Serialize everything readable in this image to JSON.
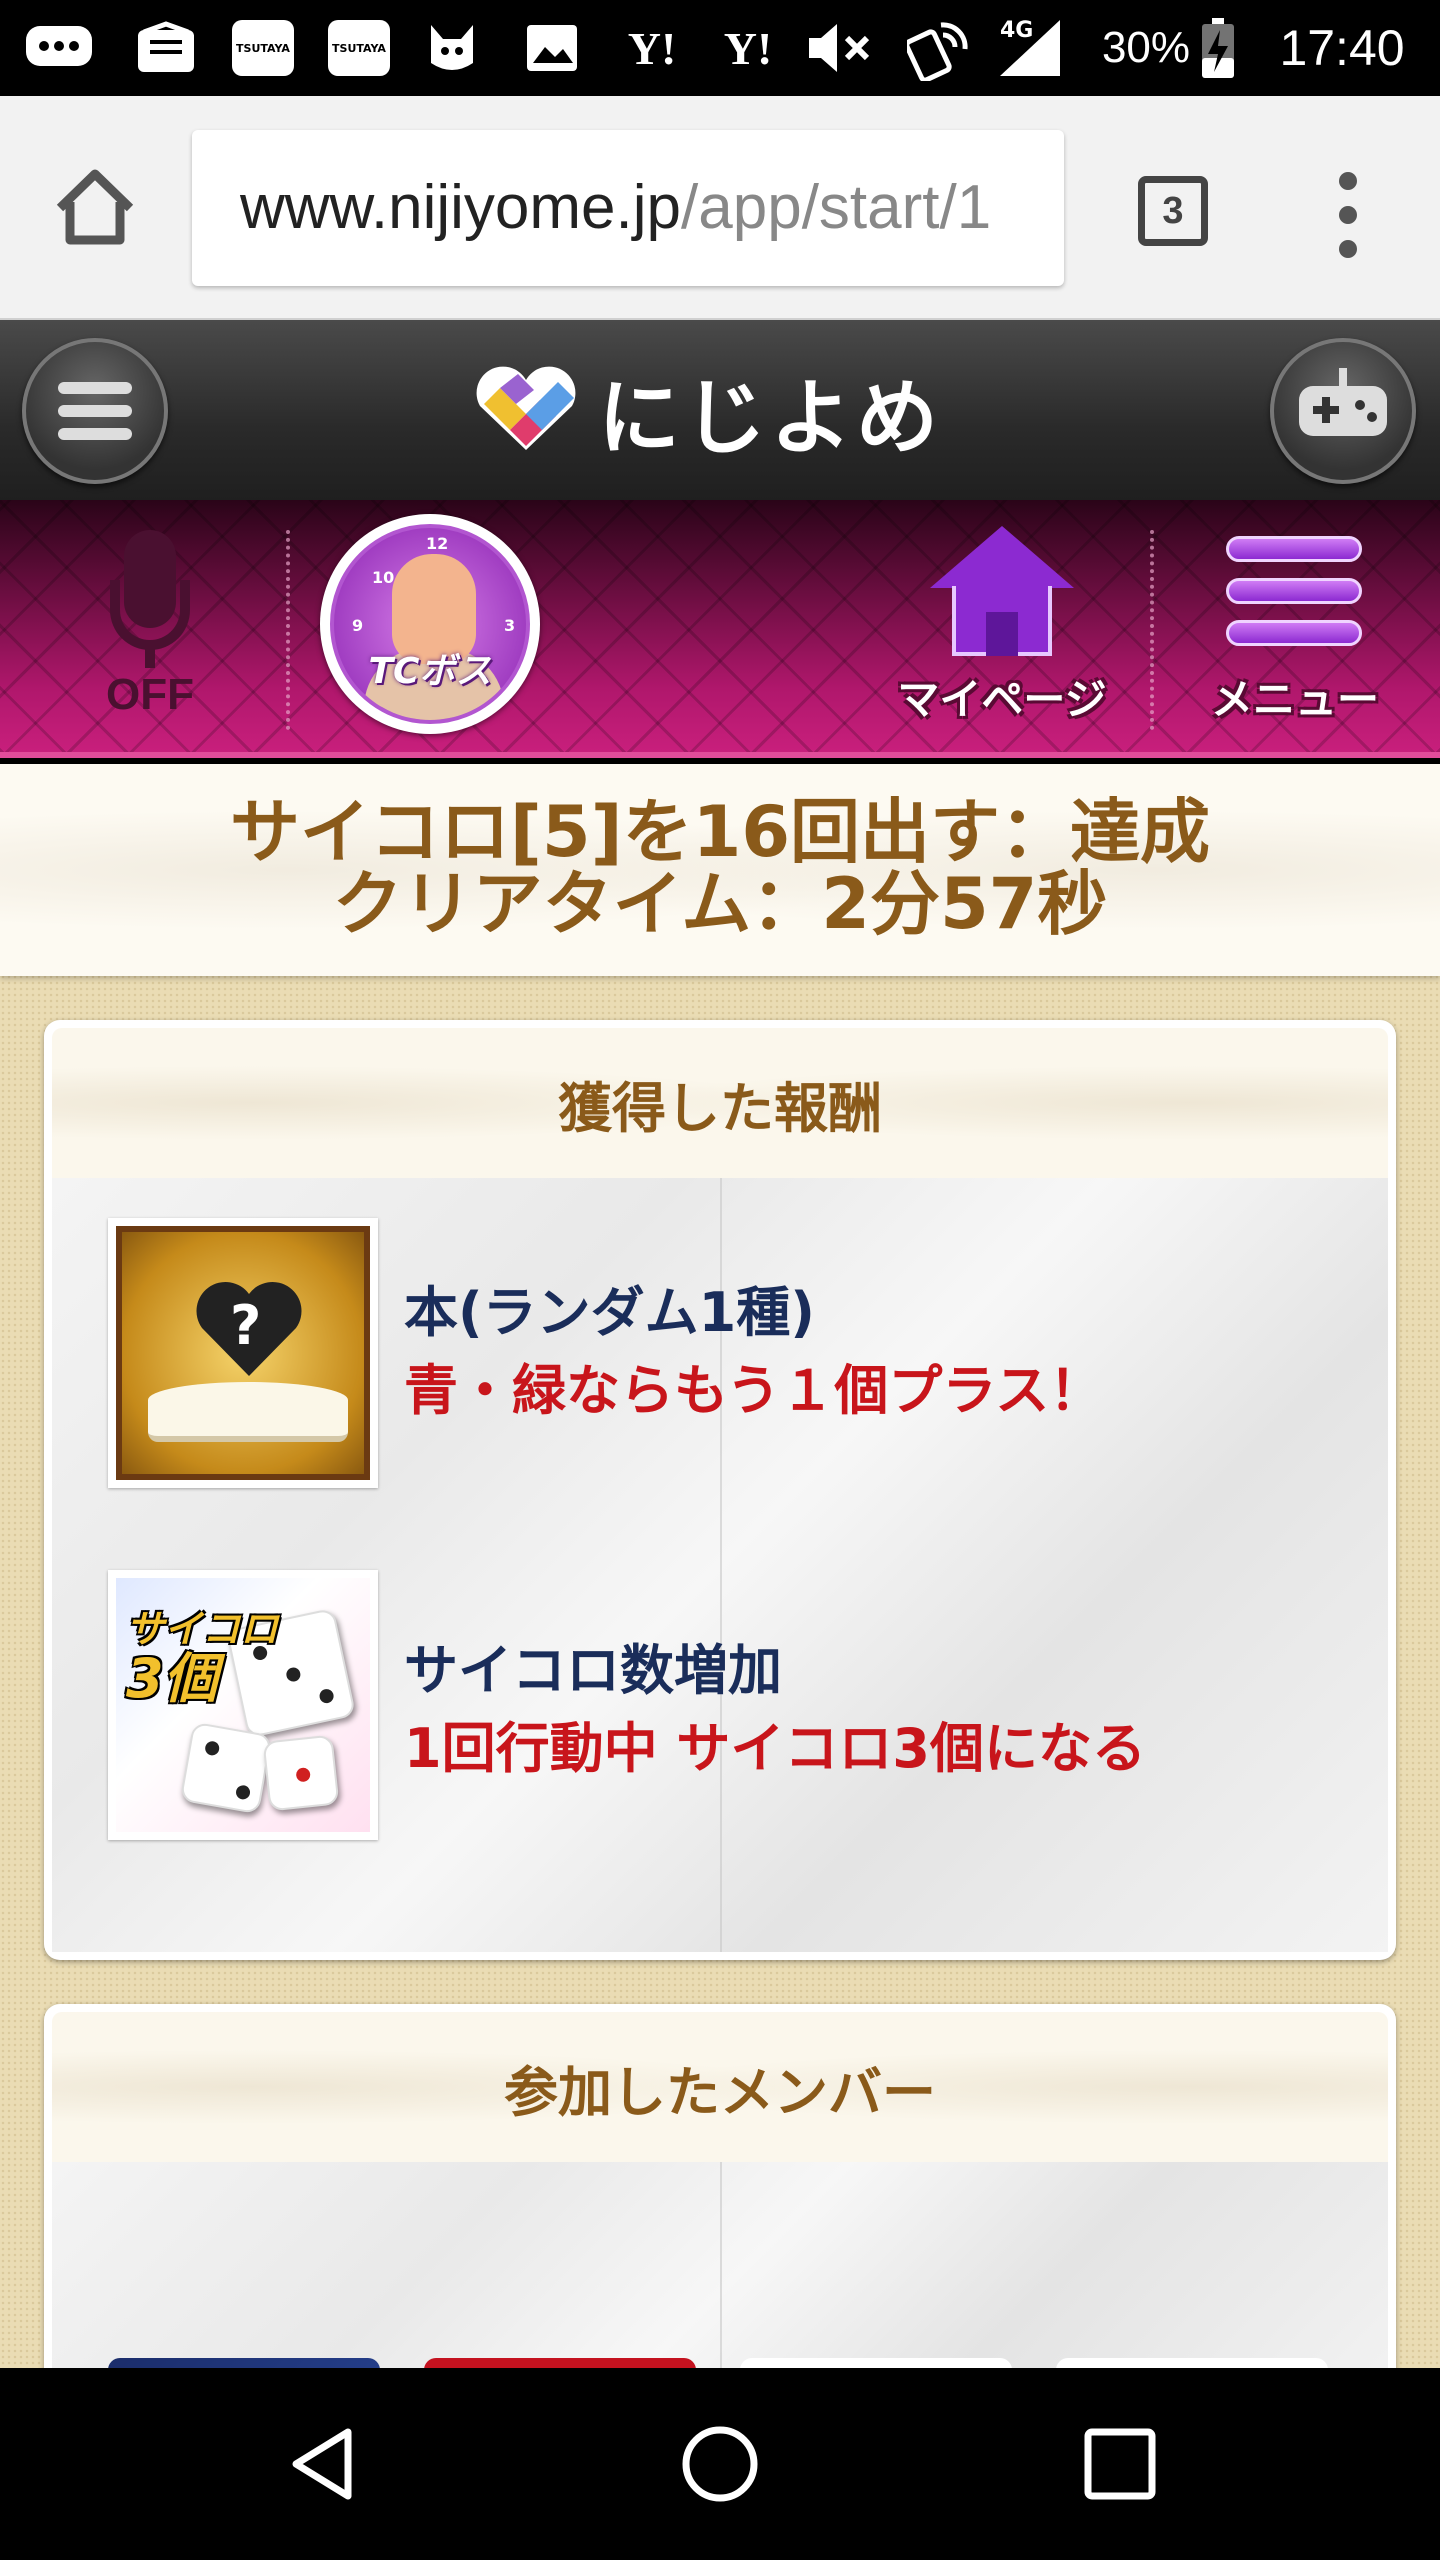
{
  "status_bar": {
    "left_icons": [
      "chat-bubble-icon",
      "mail-icon",
      "tsutaya-icon",
      "tsutaya-icon",
      "cat-app-icon",
      "image-icon",
      "yahoo-icon",
      "yahoo-icon"
    ],
    "tsutaya_label": "TSUTAYA",
    "yahoo_label": "Y!",
    "network_label": "4G",
    "battery": "30%",
    "time": "17:40"
  },
  "browser": {
    "url_host": "www.nijiyome.jp",
    "url_path": "/app/start/1",
    "tab_count": "3"
  },
  "site_header": {
    "logo_text": "にじよめ"
  },
  "game_nav": {
    "mic_label": "OFF",
    "boss_label": "TCボス",
    "mypage_label": "マイページ",
    "menu_label": "メニュー"
  },
  "result_banner": {
    "line1": "サイコロ[5]を16回出す：達成",
    "line2": "クリアタイム：2分57秒"
  },
  "rewards_section": {
    "title": "獲得した報酬",
    "items": [
      {
        "title": "本(ランダム1種)",
        "description": "青・緑ならもう１個プラス！",
        "thumb_icon": "mystery-book-icon"
      },
      {
        "title": "サイコロ数増加",
        "description": "1回行動中 サイコロ3個になる",
        "thumb_icon": "dice-icon",
        "thumb_label_1": "サイコロ",
        "thumb_label_2": "3個"
      }
    ]
  },
  "members_section": {
    "title": "参加したメンバー"
  },
  "colors": {
    "accent_brown": "#8a5a1a",
    "reward_title": "#1a2d5a",
    "reward_desc": "#c8151b",
    "nav_magenta": "#b0176c"
  }
}
